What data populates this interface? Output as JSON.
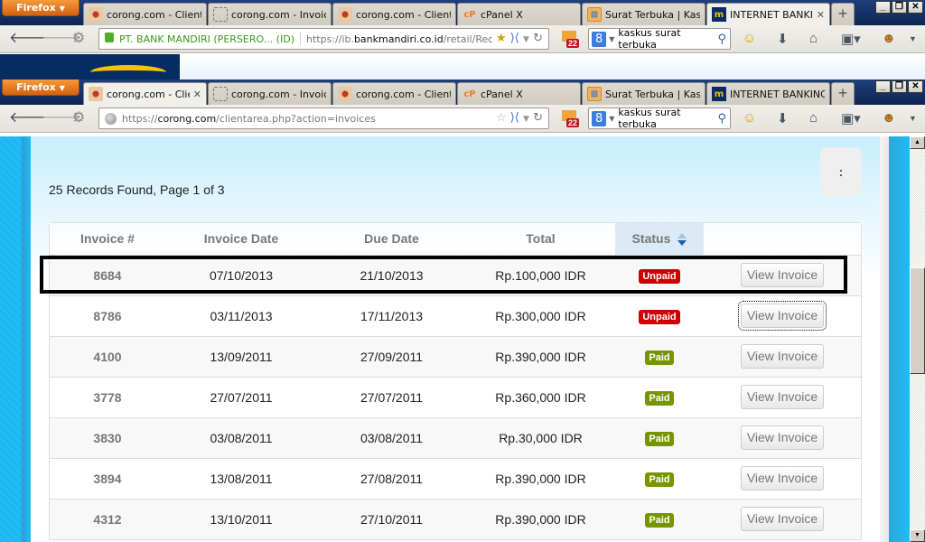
{
  "browser": {
    "menu_label": "Firefox",
    "window_controls": [
      "_",
      "❐",
      "✕"
    ],
    "new_tab_label": "+",
    "back_window": {
      "tabs": [
        {
          "icon": "corong-icon",
          "label": "corong.com - Client ..."
        },
        {
          "icon": "blank-page-icon",
          "label": "corong.com - Invoice..."
        },
        {
          "icon": "corong-icon",
          "label": "corong.com - Client ..."
        },
        {
          "icon": "cpanel-icon",
          "label": "cPanel X"
        },
        {
          "icon": "kaskus-icon",
          "label": "Surat Terbuka | Kask..."
        },
        {
          "icon": "mandiri-icon",
          "label": "INTERNET BANKI...",
          "active": true
        }
      ],
      "identity": "PT. BANK MANDIRI (PERSERO... (ID)",
      "url_prefix": "https://ib.",
      "url_domain": "bankmandiri.co.id",
      "url_path": "/retail/Redirect.",
      "mail_count": "22",
      "search_value": "kaskus surat terbuka"
    },
    "front_window": {
      "tabs": [
        {
          "icon": "corong-icon",
          "label": "corong.com - Clie...",
          "active": true
        },
        {
          "icon": "blank-page-icon",
          "label": "corong.com - Invoice..."
        },
        {
          "icon": "corong-icon",
          "label": "corong.com - Client ..."
        },
        {
          "icon": "cpanel-icon",
          "label": "cPanel X"
        },
        {
          "icon": "kaskus-icon",
          "label": "Surat Terbuka | Kask..."
        },
        {
          "icon": "mandiri-icon",
          "label": "INTERNET BANKING ..."
        }
      ],
      "url_prefix": "https://",
      "url_domain": "corong.com",
      "url_path": "/clientarea.php?action=invoices",
      "mail_count": "22",
      "search_value": "kaskus surat terbuka"
    }
  },
  "page": {
    "records_summary": "25 Records Found, Page 1 of 3",
    "menu_button_label": ":",
    "table": {
      "columns": [
        "Invoice #",
        "Invoice Date",
        "Due Date",
        "Total",
        "Status",
        ""
      ],
      "sorted_column": "Status",
      "rows": [
        {
          "invoice": "8684",
          "date": "07/10/2013",
          "due": "21/10/2013",
          "total": "Rp.100,000 IDR",
          "status": "Unpaid",
          "action": "View Invoice",
          "highlighted": true
        },
        {
          "invoice": "8786",
          "date": "03/11/2013",
          "due": "17/11/2013",
          "total": "Rp.300,000 IDR",
          "status": "Unpaid",
          "action": "View Invoice",
          "focused": true
        },
        {
          "invoice": "4100",
          "date": "13/09/2011",
          "due": "27/09/2011",
          "total": "Rp.390,000 IDR",
          "status": "Paid",
          "action": "View Invoice"
        },
        {
          "invoice": "3778",
          "date": "27/07/2011",
          "due": "27/07/2011",
          "total": "Rp.360,000 IDR",
          "status": "Paid",
          "action": "View Invoice"
        },
        {
          "invoice": "3830",
          "date": "03/08/2011",
          "due": "03/08/2011",
          "total": "Rp.30,000 IDR",
          "status": "Paid",
          "action": "View Invoice"
        },
        {
          "invoice": "3894",
          "date": "13/08/2011",
          "due": "27/08/2011",
          "total": "Rp.390,000 IDR",
          "status": "Paid",
          "action": "View Invoice"
        },
        {
          "invoice": "4312",
          "date": "13/10/2011",
          "due": "27/10/2011",
          "total": "Rp.390,000 IDR",
          "status": "Paid",
          "action": "View Invoice"
        }
      ]
    }
  },
  "colors": {
    "unpaid": "#cc0000",
    "paid": "#779500",
    "background": "#1fbbf6",
    "mandiri_navy": "#032d63",
    "mandiri_gold": "#f5c400"
  }
}
